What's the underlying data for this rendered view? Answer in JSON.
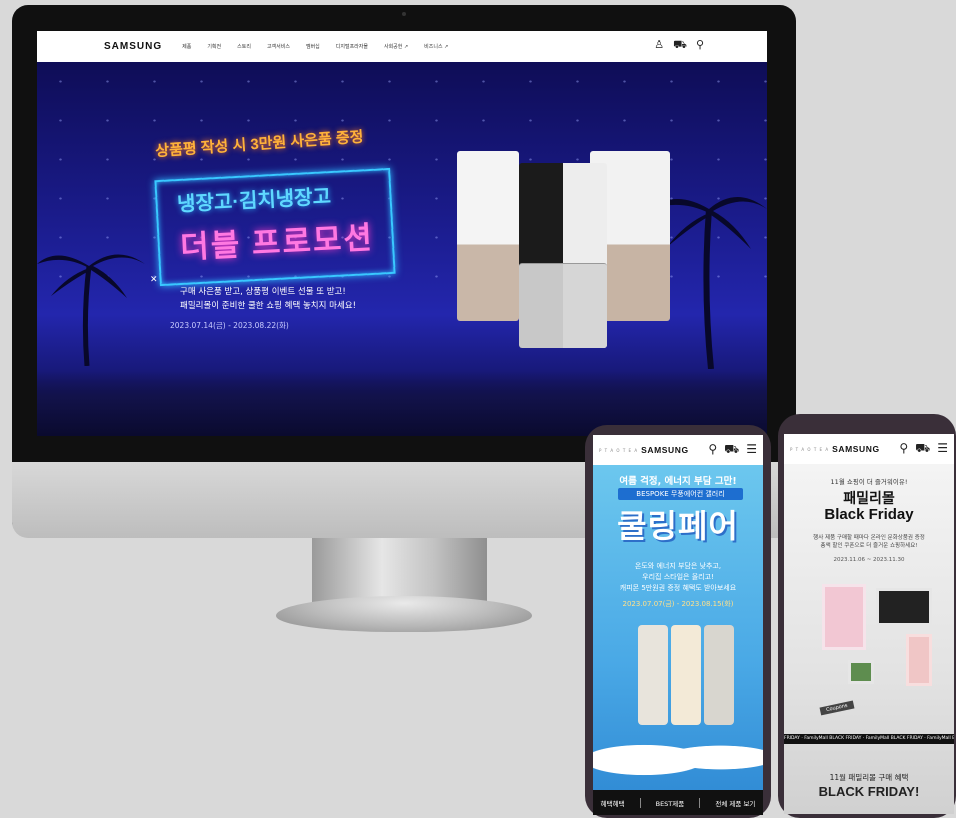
{
  "desktop": {
    "brand": "SAMSUNG",
    "menu": [
      "제품",
      "기획전",
      "스토리",
      "고객서비스",
      "멤버십",
      "디지털프라자몰",
      "사회공헌 ↗",
      "비즈니스 ↗"
    ],
    "icons": [
      "user-icon",
      "cart-icon",
      "search-icon"
    ],
    "hero": {
      "top_line": "상품평 작성 시 3만원 사은품 증정",
      "title_1": "냉장고·김치냉장고",
      "title_2": "더블 프로모션",
      "desc_1": "구매 사은품 받고, 상품평 이벤트 선물 또 받고!",
      "desc_2": "패밀리몰이 준비한 쿨한 쇼핑 혜택 놓치지 마세요!",
      "date": "2023.07.14(금) - 2023.08.22(화)"
    },
    "accent": "#1a1b8a"
  },
  "phone_left": {
    "brand": "SAMSUNG",
    "dots": "P T A O T E A",
    "hero": {
      "line_1": "여름 걱정, 에너지 부담 그만!",
      "line_2": "BESPOKE 무풍에어컨 갤러리",
      "title": "쿨링페어",
      "desc_1": "온도와 에너지 부담은 낮추고,",
      "desc_2": "우리집 스타일은 올리고!",
      "desc_3": "캐피몬 5만원권 증정 혜택도 받아보세요",
      "date": "2023.07.07(금) - 2023.08.15(화)"
    },
    "tabs": [
      "혜택혜택",
      "BEST제품",
      "전체 제품 보기"
    ]
  },
  "phone_right": {
    "brand": "SAMSUNG",
    "dots": "P T A O T E A",
    "hero": {
      "small": "11월 쇼핑이 더 즐거워이유!",
      "title_1": "패밀리몰",
      "title_2": "Black Friday",
      "desc_1": "행사 제품 구매할 때마다 온라인 문화상품권 증정",
      "desc_2": "총액 할인 쿠폰으로 더 즐거운 쇼핑하세요!",
      "date": "2023.11.06 ~ 2023.11.30",
      "coupon": "Coupons",
      "ticker": "FRIDAY · FamilyMall BLACK FRIDAY · FamilyMall BLACK FRIDAY · FamilyMall BLACK FRIDAY",
      "bottom_1": "11월 패밀리몰 구매 혜택",
      "bottom_2": "BLACK FRIDAY!"
    }
  }
}
